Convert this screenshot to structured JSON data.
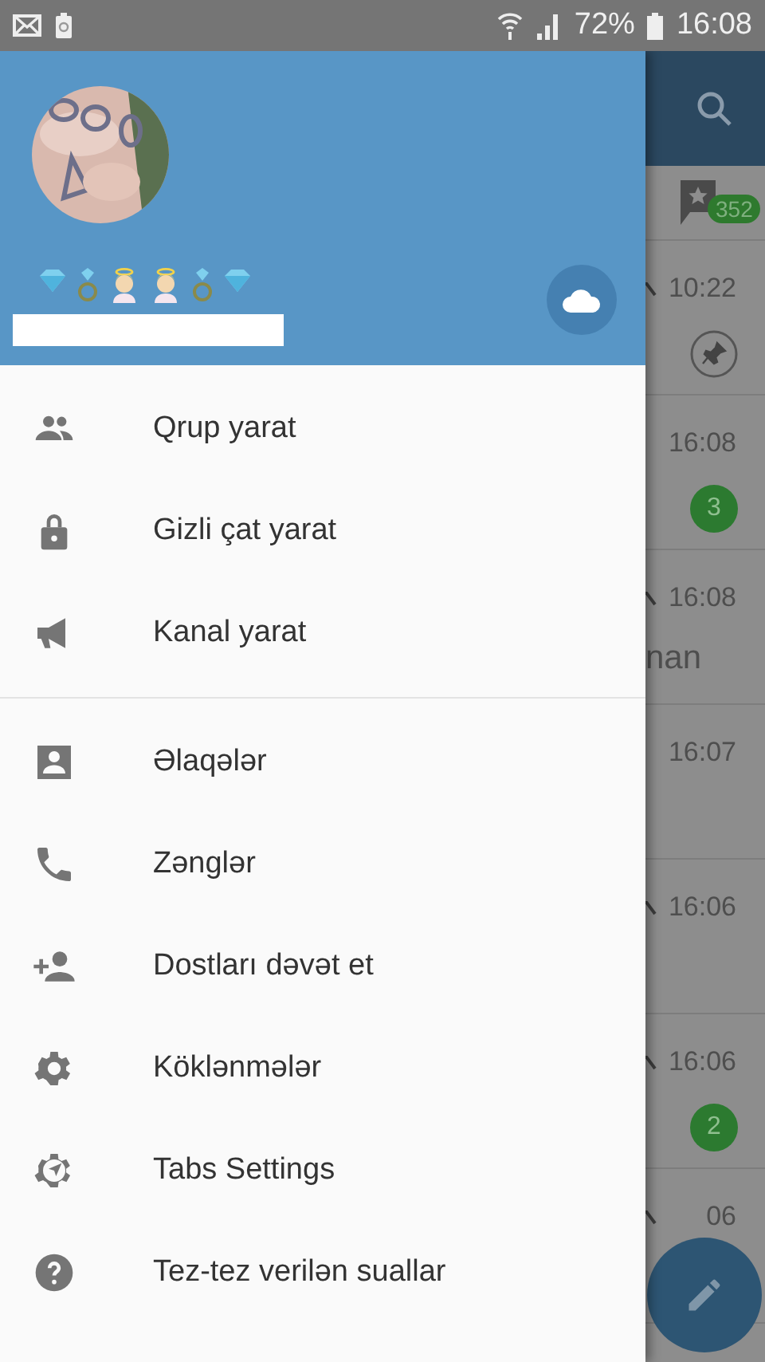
{
  "status_bar": {
    "battery": "72%",
    "time": "16:08"
  },
  "drawer": {
    "menu_groups": [
      [
        {
          "label": "Qrup yarat",
          "kind": "group"
        },
        {
          "label": "Gizli çat yarat",
          "kind": "lock"
        },
        {
          "label": "Kanal yarat",
          "kind": "megaphone"
        }
      ],
      [
        {
          "label": "Əlaqələr",
          "kind": "contact"
        },
        {
          "label": "Zənglər",
          "kind": "phone"
        },
        {
          "label": "Dostları dəvət et",
          "kind": "invite"
        },
        {
          "label": "Köklənmələr",
          "kind": "gear"
        },
        {
          "label": "Tabs Settings",
          "kind": "compass"
        },
        {
          "label": "Tez-tez verilən suallar",
          "kind": "help"
        }
      ]
    ]
  },
  "chat_list": {
    "favorites_count": "352",
    "rows": [
      {
        "time": "10:22",
        "tick": true,
        "pinned": true
      },
      {
        "time": "16:08",
        "tick": false,
        "pinned": false,
        "badge": "3"
      },
      {
        "time": "16:08",
        "tick": true,
        "pinned": false,
        "snippet": "nan"
      },
      {
        "time": "16:07",
        "tick": false,
        "pinned": false
      },
      {
        "time": "16:06",
        "tick": true,
        "pinned": false
      },
      {
        "time": "16:06",
        "tick": true,
        "pinned": false,
        "badge": "2"
      },
      {
        "time": "06",
        "tick": true,
        "pinned": false
      }
    ]
  }
}
